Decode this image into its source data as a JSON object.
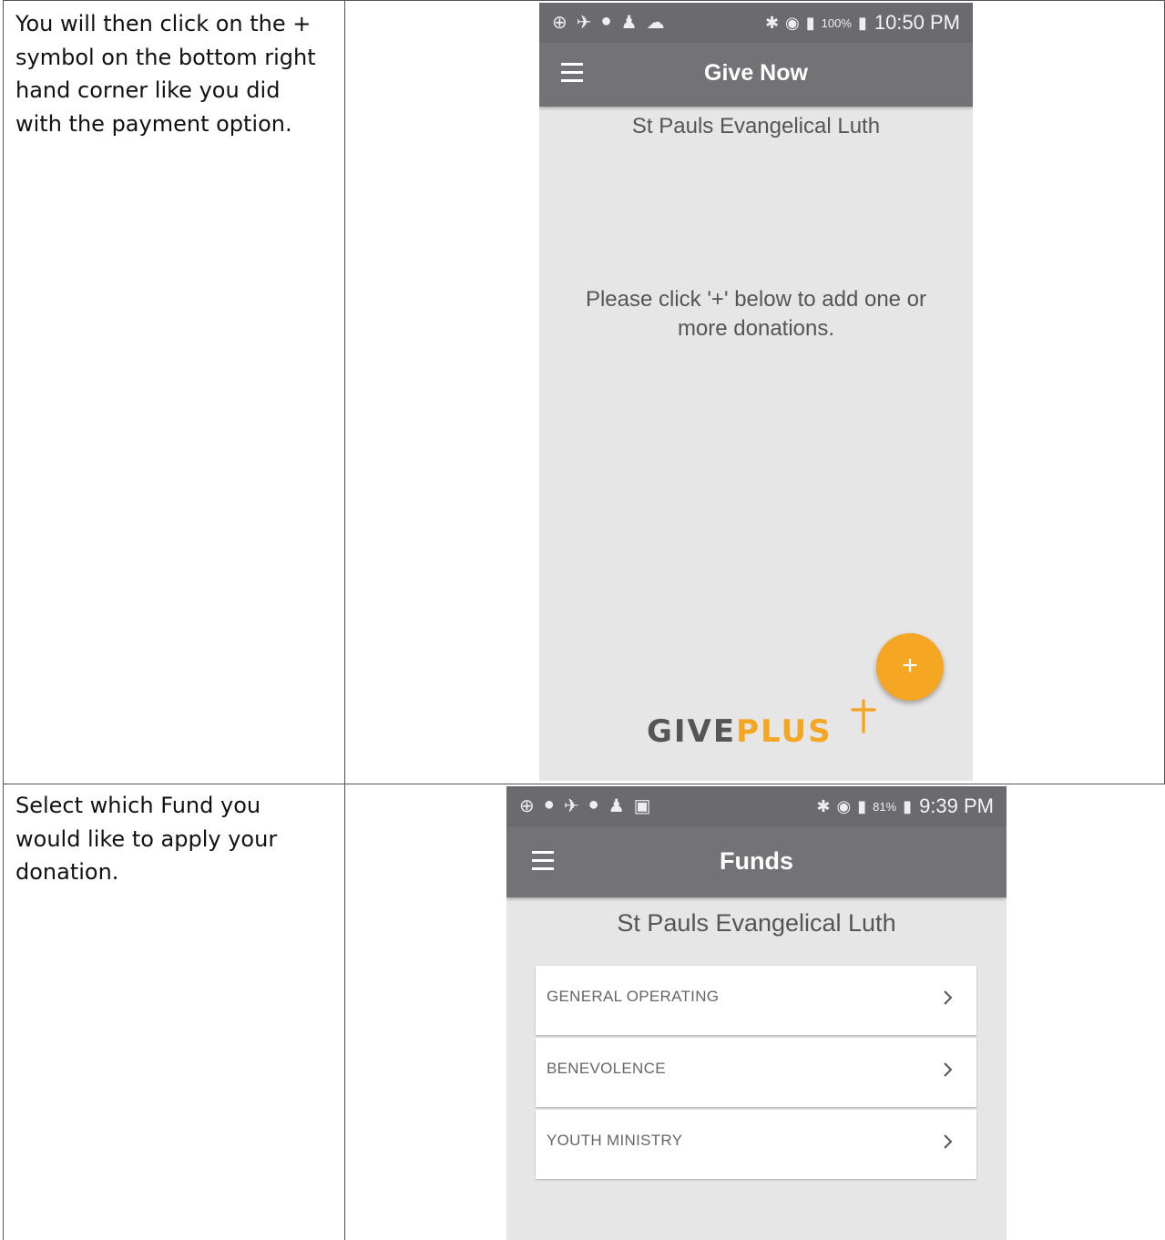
{
  "rows": [
    {
      "instruction_lines": [
        "You will then click on the +",
        "symbol on the bottom right",
        "hand corner like you did",
        "with the payment option."
      ],
      "screen": {
        "status_time": "10:50 PM",
        "battery": "100%",
        "title": "Give Now",
        "org_name": "St Pauls Evangelical Luth",
        "hint": "Please click '+' below to add one or more donations.",
        "fab_label": "+",
        "logo_give": "GIVE",
        "logo_plus": "PLUS",
        "logo_color": "#f5a623",
        "icons": [
          "menu-icon",
          "add-icon",
          "cross-icon"
        ]
      }
    },
    {
      "instruction_lines": [
        "Select which Fund you",
        "would like to apply your",
        "donation."
      ],
      "screen": {
        "status_time": "9:39 PM",
        "battery": "81%",
        "title": "Funds",
        "org_name": "St Pauls Evangelical Luth",
        "funds": [
          "GENERAL OPERATING",
          "BENEVOLENCE",
          "YOUTH MINISTRY"
        ],
        "icons": [
          "menu-icon",
          "chevron-right-icon"
        ]
      }
    }
  ],
  "colors": {
    "appbar": "#737276",
    "statusbar": "#6b6a6f",
    "accent": "#f5a623",
    "screen_bg": "#e6e6e6"
  }
}
